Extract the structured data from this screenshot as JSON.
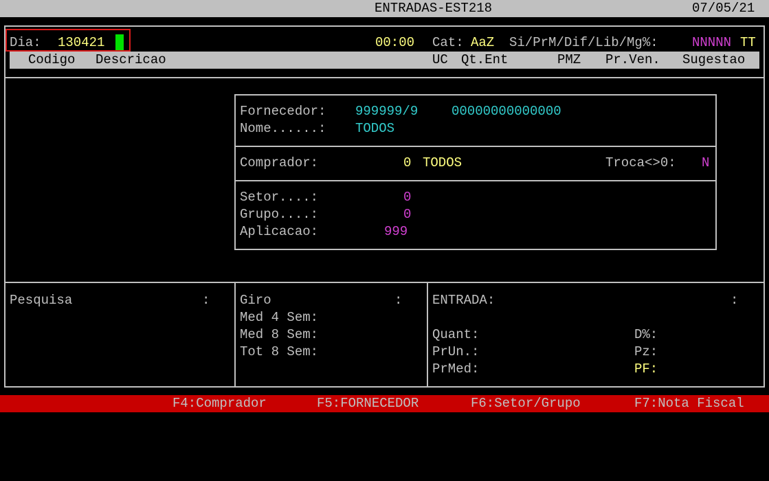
{
  "header": {
    "title": "ENTRADAS-EST218",
    "date": "07/05/21"
  },
  "row1": {
    "dia_label": "Dia:",
    "dia_value": "130421",
    "time": "00:00",
    "cat_label": "Cat:",
    "cat_value": "AaZ",
    "flags_label": "Si/PrM/Dif/Lib/Mg%:",
    "flags_value_n": "NNNNN",
    "flags_value_t": "TT"
  },
  "columns": {
    "codigo": "Codigo",
    "descricao": "Descricao",
    "uc": "UC",
    "qt_ent": "Qt.Ent",
    "pmz": "PMZ",
    "pr_ven": "Pr.Ven.",
    "sugestao": "Sugestao"
  },
  "filter": {
    "fornecedor_label": "Fornecedor:",
    "fornecedor_code": "999999/9",
    "fornecedor_doc": "00000000000000",
    "nome_label": "Nome......:",
    "nome_value": "TODOS",
    "comprador_label": "Comprador:",
    "comprador_code": "0",
    "comprador_name": "TODOS",
    "troca_label": "Troca<>0:",
    "troca_value": "N",
    "setor_label": "Setor....:",
    "setor_value": "0",
    "grupo_label": "Grupo....:",
    "grupo_value": "0",
    "aplicacao_label": "Aplicacao:",
    "aplicacao_value": "999"
  },
  "bottom": {
    "pesquisa_label": "Pesquisa",
    "colon": ":",
    "giro_label": "Giro",
    "med4_label": "Med 4 Sem:",
    "med8_label": "Med 8 Sem:",
    "tot8_label": "Tot 8 Sem:",
    "entrada_label": "ENTRADA:",
    "quant_label": "Quant:",
    "prun_label": "PrUn.:",
    "prmed_label": "PrMed:",
    "dpct_label": "D%:",
    "pz_label": "Pz:",
    "pf_label": "PF:"
  },
  "fkeys": {
    "f4": "F4:Comprador",
    "f5": "F5:FORNECEDOR",
    "f6": "F6:Setor/Grupo",
    "f7": "F7:Nota Fiscal"
  },
  "colors": {
    "text": "#c0c0c0",
    "yellow": "#ffff80",
    "cyan": "#33cccc",
    "magenta": "#d040d0",
    "cursor": "#00e000",
    "fkey_bar": "#c80000",
    "highlight": "#d81b1b"
  }
}
